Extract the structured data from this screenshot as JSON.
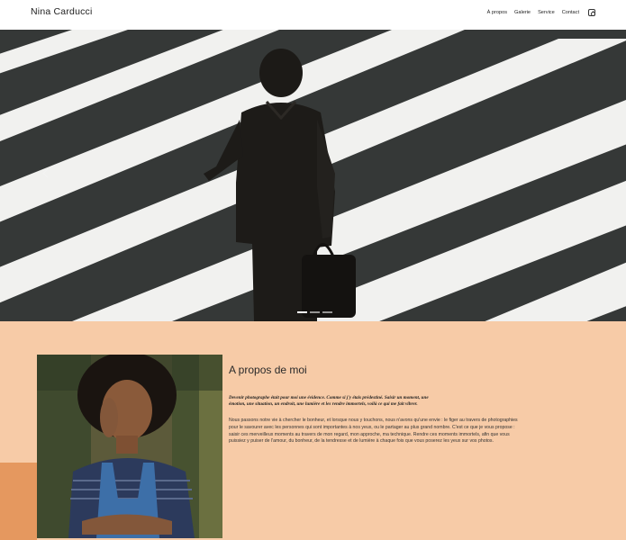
{
  "header": {
    "brand": "Nina Carducci",
    "nav": [
      "À propos",
      "Galerie",
      "Service",
      "Contact"
    ],
    "social_icon": "instagram-icon"
  },
  "hero": {
    "slides_count": 3,
    "active_slide": 1,
    "prev_icon": "chevron-left-icon"
  },
  "about": {
    "title": "A propos de moi",
    "lead": "Devenir photographe était pour moi une évidence. Comme si j'y étais prédestiné. Saisir un moment, une émotion, une situation, un endroit, une lumière et les rendre immortels, voilà ce qui me fait vibrer.",
    "body": "Nous passons notre vie à chercher le bonheur, et lorsque nous y touchons, nous n'avons qu'une envie : le figer au travers de photographies pour le savourer avec les personnes qui sont importantes à nos yeux, ou le partager au plus grand nombre. C'est ce que je vous propose : saisir ces merveilleux moments au travers de mon regard, mon approche, ma technique. Rendre ces moments immortels, afin que vous puissiez y puiser de l'amour, du bonheur, de la tendresse et de lumière à chaque fois que vous poserez les yeux sur vos photos."
  },
  "colors": {
    "about_bg": "#f7cba7",
    "accent_block": "#e5985f"
  }
}
